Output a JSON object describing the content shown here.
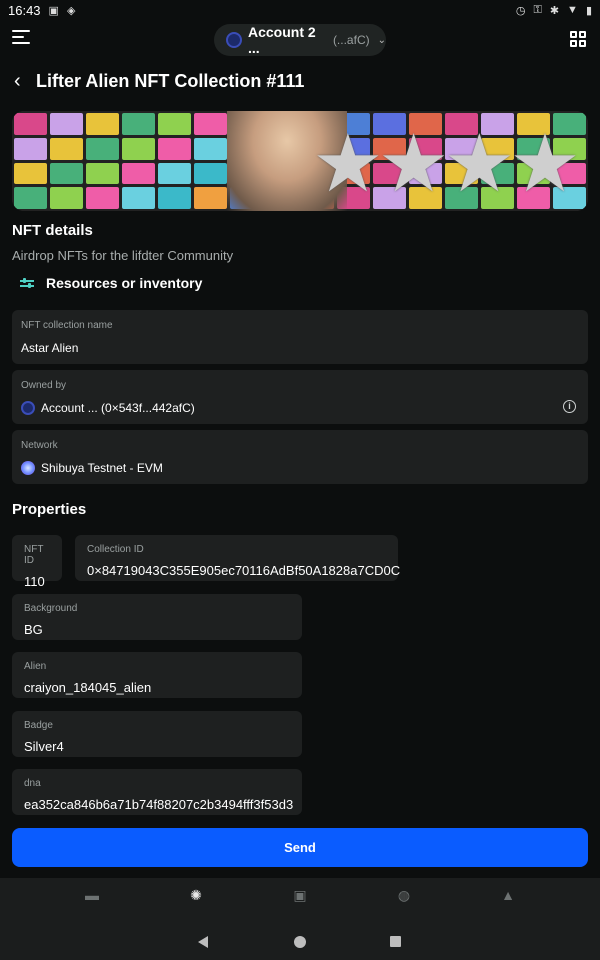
{
  "status_bar": {
    "time": "16:43"
  },
  "header": {
    "account_name": "Account 2 ...",
    "account_address": "(...afC)"
  },
  "title": "Lifter Alien NFT Collection #111",
  "details": {
    "heading": "NFT details",
    "description": "Airdrop NFTs for the lifdter Community",
    "resources_label": "Resources or inventory"
  },
  "info_cards": [
    {
      "label": "NFT collection name",
      "value": "Astar Alien"
    },
    {
      "label": "Owned by",
      "value": "Account ... (0×543f...442afC)"
    },
    {
      "label": "Network",
      "value": "Shibuya Testnet - EVM"
    }
  ],
  "properties": {
    "heading": "Properties",
    "nft_id": {
      "label": "NFT ID",
      "value": "110"
    },
    "collection_id": {
      "label": "Collection ID",
      "value": "0×84719043C355E905ec70116AdBf50A1828a7CD0C"
    },
    "background": {
      "label": "Background",
      "value": "BG"
    },
    "alien": {
      "label": "Alien",
      "value": "craiyon_184045_alien"
    },
    "badge": {
      "label": "Badge",
      "value": "Silver4"
    },
    "dna": {
      "label": "dna",
      "value": "ea352ca846b6a71b74f88207c2b3494fff3f53d3"
    }
  },
  "send_label": "Send",
  "bottom_nav": [
    "wallet-icon",
    "nft-aperture-icon",
    "vault-icon",
    "globe-icon",
    "rocket-icon"
  ],
  "colors": {
    "accent": "#0a5cff",
    "background": "#0c0e0e",
    "card": "#1e2020"
  }
}
